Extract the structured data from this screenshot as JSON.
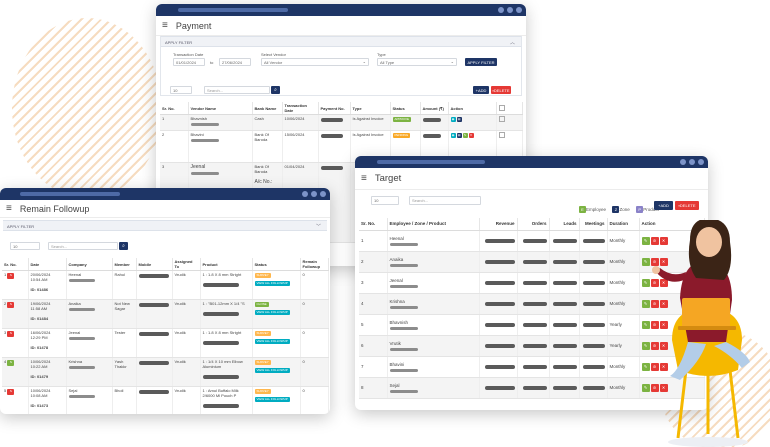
{
  "colors": {
    "navy": "#1e3566",
    "green": "#7cb342",
    "yellow": "#f9a825",
    "teal": "#00acc1",
    "red": "#e53935",
    "lavender": "#8a82c8",
    "orange": "#ffb74d"
  },
  "payment": {
    "title": "Payment",
    "filter_label": "APPLY FILTER",
    "transaction_date_label": "Transaction Date",
    "date_from": "01/01/2024",
    "to_label": "to",
    "date_to": "27/06/2024",
    "vendor_label": "Select Vendor",
    "vendor_value": "All Vendor",
    "type_label": "Type",
    "type_value": "All Type",
    "apply_btn": "APPLY FILTER",
    "page_size": "10",
    "search_placeholder": "Search...",
    "add_btn": "ADD",
    "delete_btn": "DELETE",
    "columns": [
      "Sr. No.",
      "Vendor Name",
      "Bank Name",
      "Transaction Date",
      "Payment No.",
      "Type",
      "Status",
      "Amount (₹)",
      "Action",
      ""
    ],
    "rows": [
      {
        "sr": "1",
        "vendor": "Bhavnish",
        "bank": "Cash",
        "date": "10/06/2024",
        "type": "Is Against Invoice",
        "status": "APPROVE",
        "status_color": "green"
      },
      {
        "sr": "2",
        "vendor": "Bhavini",
        "bank": "Bank Of Baroda",
        "date": "15/06/2024",
        "type": "Is Against Invoice",
        "status": "PENDING",
        "status_color": "yellow"
      },
      {
        "sr": "3",
        "vendor": "Jeenal",
        "bank": "Bank Of Baroda",
        "bank2": "A/c No.:",
        "date": "01/04/2024",
        "type": "",
        "status": "",
        "status_color": ""
      }
    ]
  },
  "followup": {
    "title": "Remain Followup",
    "filter_label": "APPLY FILTER",
    "page_size": "10",
    "search_placeholder": "Search...",
    "columns": [
      "Sr. No.",
      "Date",
      "Company",
      "Member",
      "Mobile",
      "Assigned To",
      "Product",
      "Status",
      "Remain Followup"
    ],
    "view_all": "VIEW ALL FOLLOWUP",
    "rows": [
      {
        "sr": "1",
        "badge_color": "red",
        "date": "20/06/2024",
        "time": "10:54 AM",
        "id": "ID: 01486",
        "company": "Heenal",
        "member": "Rahul",
        "assigned": "Vrudik",
        "product": "1 : 1.8 X 8 mm Stright",
        "status": "SURVEY",
        "status_color": "orange",
        "remain": "0"
      },
      {
        "sr": "2",
        "badge_color": "red",
        "date": "19/06/2024",
        "time": "11:58 AM",
        "id": "ID: 01484",
        "company": "Anaika",
        "member": "Not New Sagar",
        "assigned": "Vrudik",
        "product": "1 : \"B01-12mm X 1/4 \"S",
        "status": "CLOSE",
        "status_color": "green",
        "remain": "0"
      },
      {
        "sr": "3",
        "badge_color": "red",
        "date": "16/06/2024",
        "time": "12:29 PM",
        "id": "ID: 01478",
        "company": "Jeenal",
        "member": "Tester",
        "assigned": "Vrudik",
        "product": "1 : 1.8 X 8 mm Stright",
        "status": "SURVEY",
        "status_color": "orange",
        "remain": "0"
      },
      {
        "sr": "4",
        "badge_color": "green",
        "date": "10/06/2024",
        "time": "10:22 AM",
        "id": "ID: 01479",
        "company": "Krishna",
        "member": "Yash Thakkr",
        "assigned": "Vrudik",
        "product": "1 : 1/4 X 10 mm Elbow Aluminium",
        "status": "SURVEY",
        "status_color": "orange",
        "remain": "0"
      },
      {
        "sr": "5",
        "badge_color": "red",
        "date": "10/06/2024",
        "time": "10:08 AM",
        "id": "ID: 01473",
        "company": "Sejal",
        "member": "Bhoil",
        "assigned": "Vrudik",
        "product": "1 : Amul Buffalo Milk 2/6000 Ml Pouch P",
        "status": "SURVEY",
        "status_color": "orange",
        "remain": "0"
      }
    ]
  },
  "target": {
    "title": "Target",
    "page_size": "10",
    "search_placeholder": "Search...",
    "legend": [
      {
        "key": "E",
        "label": "Employee",
        "color": "green"
      },
      {
        "key": "Z",
        "label": "Zone",
        "color": "navy"
      },
      {
        "key": "P",
        "label": "Product",
        "color": "lavender"
      }
    ],
    "add_btn": "ADD",
    "delete_btn": "DELETE",
    "columns": [
      "Sr. No.",
      "Employee / Zone / Product",
      "Revenue",
      "Orders",
      "Leads",
      "Meetings",
      "Duration",
      "Action"
    ],
    "rows": [
      {
        "sr": "1",
        "name": "Heenal",
        "duration": "Monthly"
      },
      {
        "sr": "2",
        "name": "Anaika",
        "duration": "Monthly"
      },
      {
        "sr": "3",
        "name": "Jeenal",
        "duration": "Monthly"
      },
      {
        "sr": "4",
        "name": "Krishna",
        "duration": "Monthly"
      },
      {
        "sr": "5",
        "name": "Bhavnish",
        "duration": "Yearly"
      },
      {
        "sr": "6",
        "name": "Vrutik",
        "duration": "Yearly"
      },
      {
        "sr": "7",
        "name": "Bhavini",
        "duration": "Monthly"
      },
      {
        "sr": "8",
        "name": "Sejal",
        "duration": "Monthly"
      }
    ]
  }
}
